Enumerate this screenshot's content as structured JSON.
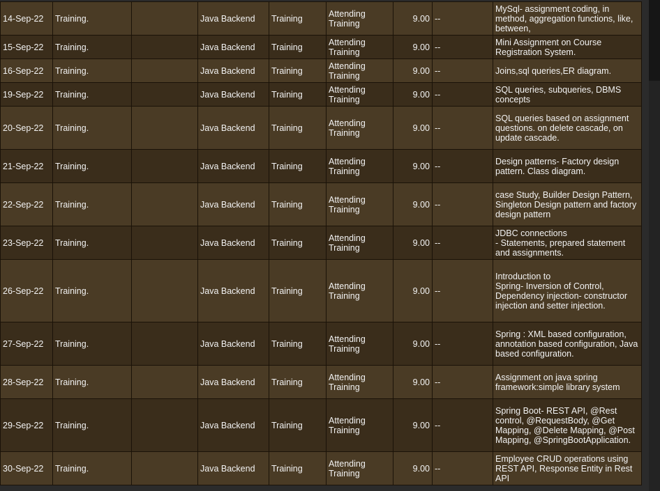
{
  "rows": [
    {
      "date": "14-Sep-22",
      "activity": "Training.",
      "remarks": "",
      "project": "Java Backend",
      "type": "Training",
      "status": "Attending Training",
      "hours": "9.00",
      "dash": "--",
      "description": "MySql- assignment coding, in method, aggregation functions, like, between,"
    },
    {
      "date": "15-Sep-22",
      "activity": "Training.",
      "remarks": "",
      "project": "Java Backend",
      "type": "Training",
      "status": "Attending Training",
      "hours": "9.00",
      "dash": "--",
      "description": "Mini Assignment on Course Registration System."
    },
    {
      "date": "16-Sep-22",
      "activity": "Training.",
      "remarks": "",
      "project": "Java Backend",
      "type": "Training",
      "status": "Attending Training",
      "hours": "9.00",
      "dash": "--",
      "description": "Joins,sql queries,ER diagram."
    },
    {
      "date": "19-Sep-22",
      "activity": "Training.",
      "remarks": "",
      "project": "Java Backend",
      "type": "Training",
      "status": "Attending Training",
      "hours": "9.00",
      "dash": "--",
      "description": "SQL queries, subqueries, DBMS concepts"
    },
    {
      "date": "20-Sep-22",
      "activity": "Training.",
      "remarks": "",
      "project": "Java Backend",
      "type": "Training",
      "status": "Attending Training",
      "hours": "9.00",
      "dash": "--",
      "description": "SQL queries based on assignment questions. on delete cascade, on update cascade."
    },
    {
      "date": "21-Sep-22",
      "activity": "Training.",
      "remarks": "",
      "project": "Java Backend",
      "type": "Training",
      "status": "Attending Training",
      "hours": "9.00",
      "dash": "--",
      "description": "Design patterns- Factory design pattern. Class diagram."
    },
    {
      "date": "22-Sep-22",
      "activity": "Training.",
      "remarks": "",
      "project": "Java Backend",
      "type": "Training",
      "status": "Attending Training",
      "hours": "9.00",
      "dash": "--",
      "description": "case Study, Builder Design Pattern, Singleton Design pattern and factory design pattern"
    },
    {
      "date": "23-Sep-22",
      "activity": "Training.",
      "remarks": "",
      "project": "Java Backend",
      "type": "Training",
      "status": "Attending Training",
      "hours": "9.00",
      "dash": "--",
      "description": "JDBC connections\n- Statements, prepared statement and assignments."
    },
    {
      "date": "26-Sep-22",
      "activity": "Training.",
      "remarks": "",
      "project": "Java Backend",
      "type": "Training",
      "status": "Attending Training",
      "hours": "9.00",
      "dash": "--",
      "description": "Introduction to\nSpring- Inversion of Control, Dependency injection- constructor injection and setter injection."
    },
    {
      "date": "27-Sep-22",
      "activity": "Training.",
      "remarks": "",
      "project": "Java Backend",
      "type": "Training",
      "status": "Attending Training",
      "hours": "9.00",
      "dash": "--",
      "description": "Spring : XML based configuration, annotation based configuration, Java based configuration."
    },
    {
      "date": "28-Sep-22",
      "activity": "Training.",
      "remarks": "",
      "project": "Java Backend",
      "type": "Training",
      "status": "Attending Training",
      "hours": "9.00",
      "dash": "--",
      "description": "Assignment on java spring framework:simple library system"
    },
    {
      "date": "29-Sep-22",
      "activity": "Training.",
      "remarks": "",
      "project": "Java Backend",
      "type": "Training",
      "status": "Attending Training",
      "hours": "9.00",
      "dash": "--",
      "description": "Spring Boot- REST API, @Rest control, @RequestBody, @Get Mapping, @Delete Mapping, @Post Mapping, @SpringBootApplication."
    },
    {
      "date": "30-Sep-22",
      "activity": "Training.",
      "remarks": "",
      "project": "Java Backend",
      "type": "Training",
      "status": "Attending Training",
      "hours": "9.00",
      "dash": "--",
      "description": "Employee CRUD operations using REST API, Response Entity in Rest API"
    }
  ],
  "colors": {
    "row_odd": "#4a3b25",
    "row_even": "#3a2d1b",
    "grid": "#1a1208",
    "text": "#f2f2f2",
    "page_bg": "#2b2b2b"
  }
}
